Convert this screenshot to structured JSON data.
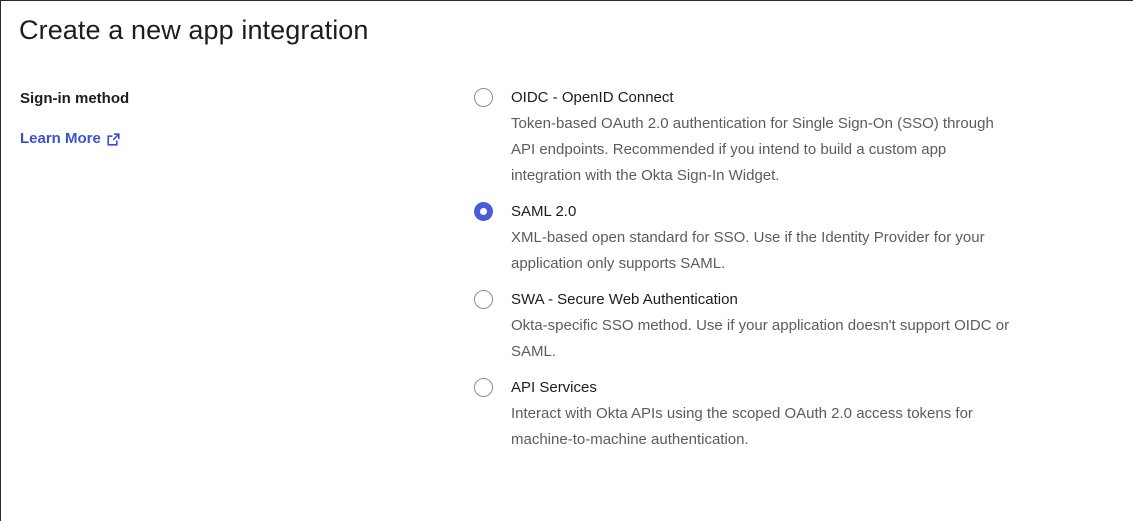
{
  "page": {
    "title": "Create a new app integration"
  },
  "sign_in": {
    "label": "Sign-in method",
    "learn_more": "Learn More",
    "learn_more_icon": "external-link-icon",
    "accent_color": "#3a52d1"
  },
  "options": [
    {
      "title": "OIDC - OpenID Connect",
      "desc_lines": [
        "Token-based OAuth 2.0 authentication for Single Sign-On (SSO) through",
        "API endpoints. Recommended if you intend to build a custom app",
        "integration with the Okta Sign-In Widget."
      ],
      "selected": false
    },
    {
      "title": "SAML 2.0",
      "desc_lines": [
        "XML-based open standard for SSO. Use if the Identity Provider for your",
        "application only supports SAML."
      ],
      "selected": true
    },
    {
      "title": "SWA - Secure Web Authentication",
      "desc_lines": [
        "Okta-specific SSO method. Use if your application doesn't support OIDC or",
        "SAML."
      ],
      "selected": false
    },
    {
      "title": "API Services",
      "desc_lines": [
        "Interact with Okta APIs using the scoped OAuth 2.0 access tokens for",
        "machine-to-machine authentication."
      ],
      "selected": false
    }
  ],
  "colors": {
    "selected_radio": "#4b5bd6",
    "unselected_radio_border": "#8c8c96",
    "description_text": "#5b5b66"
  }
}
